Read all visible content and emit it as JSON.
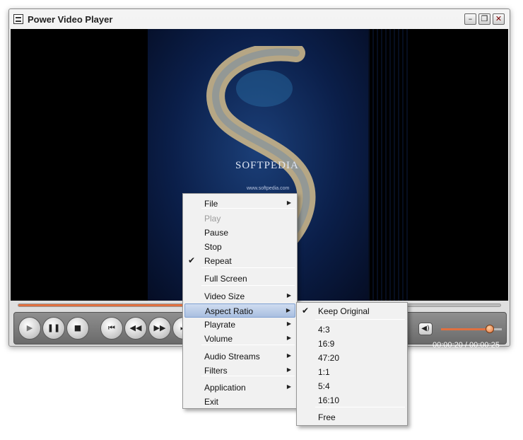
{
  "window": {
    "title": "Power Video Player",
    "buttons": {
      "minimize": "–",
      "maximize": "❐",
      "close": "✕"
    }
  },
  "video": {
    "watermark": "SOFTPEDIA",
    "url": "www.softpedia.com"
  },
  "controls": {
    "seek_progress": 0.41,
    "volume_level": 0.8,
    "time_display": "00:00:20 / 00:00:25",
    "icons": {
      "play": "▶",
      "pause": "❚❚",
      "stop": "■",
      "previous": "⏮",
      "rewind": "◀◀",
      "forward": "▶▶",
      "next": "⏭",
      "volume": "◀)"
    }
  },
  "context_menu": {
    "items": [
      {
        "label": "File",
        "has_submenu": true,
        "checked": false,
        "disabled": false
      },
      {
        "label": "Play",
        "has_submenu": false,
        "checked": false,
        "disabled": true
      },
      {
        "label": "Pause",
        "has_submenu": false,
        "checked": false,
        "disabled": false
      },
      {
        "label": "Stop",
        "has_submenu": false,
        "checked": false,
        "disabled": false
      },
      {
        "label": "Repeat",
        "has_submenu": false,
        "checked": true,
        "disabled": false
      },
      {
        "label": "Full Screen",
        "has_submenu": false,
        "checked": false,
        "disabled": false
      },
      {
        "label": "Video Size",
        "has_submenu": true,
        "checked": false,
        "disabled": false
      },
      {
        "label": "Aspect Ratio",
        "has_submenu": true,
        "checked": false,
        "disabled": false,
        "highlighted": true
      },
      {
        "label": "Playrate",
        "has_submenu": true,
        "checked": false,
        "disabled": false
      },
      {
        "label": "Volume",
        "has_submenu": true,
        "checked": false,
        "disabled": false
      },
      {
        "label": "Audio Streams",
        "has_submenu": true,
        "checked": false,
        "disabled": false
      },
      {
        "label": "Filters",
        "has_submenu": true,
        "checked": false,
        "disabled": false
      },
      {
        "label": "Application",
        "has_submenu": true,
        "checked": false,
        "disabled": false
      },
      {
        "label": "Exit",
        "has_submenu": false,
        "checked": false,
        "disabled": false
      }
    ],
    "arrow": "▶",
    "check": "✔"
  },
  "aspect_ratio_submenu": {
    "items": [
      {
        "label": "Keep Original",
        "checked": true
      },
      {
        "label": "4:3",
        "checked": false
      },
      {
        "label": "16:9",
        "checked": false
      },
      {
        "label": "47:20",
        "checked": false
      },
      {
        "label": "1:1",
        "checked": false
      },
      {
        "label": "5:4",
        "checked": false
      },
      {
        "label": "16:10",
        "checked": false
      },
      {
        "label": "Free",
        "checked": false
      }
    ]
  }
}
